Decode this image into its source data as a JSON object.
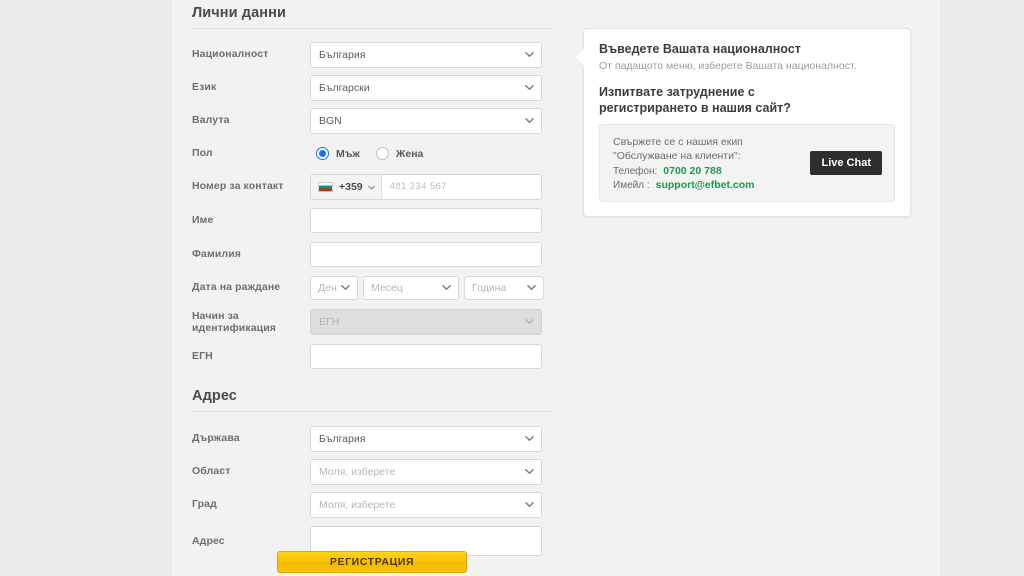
{
  "sections": {
    "personal": {
      "title": "Лични данни"
    },
    "address": {
      "title": "Адрес"
    }
  },
  "fields": {
    "nationality": {
      "label": "Националност",
      "value": "България"
    },
    "language": {
      "label": "Език",
      "value": "Български"
    },
    "currency": {
      "label": "Валута",
      "value": "BGN"
    },
    "gender": {
      "label": "Пол",
      "options": [
        {
          "label": "Мъж",
          "selected": true
        },
        {
          "label": "Жена",
          "selected": false
        }
      ]
    },
    "phone": {
      "label": "Номер за контакт",
      "dial_code": "+359",
      "placeholder": "481 234 567",
      "flag": "bulgaria-flag-icon"
    },
    "first_name": {
      "label": "Име",
      "value": ""
    },
    "last_name": {
      "label": "Фамилия",
      "value": ""
    },
    "dob": {
      "label": "Дата на раждане",
      "day": "Ден",
      "month": "Месец",
      "year": "Година"
    },
    "id_method": {
      "label": "Начин за идентификация",
      "value": "ЕГН",
      "disabled": true
    },
    "egn": {
      "label": "ЕГН",
      "value": ""
    },
    "country": {
      "label": "Държава",
      "value": "България"
    },
    "region": {
      "label": "Област",
      "value": "Моля, изберете"
    },
    "city": {
      "label": "Град",
      "value": "Моля, изберете"
    },
    "address": {
      "label": "Адрес",
      "value": ""
    }
  },
  "tooltip": {
    "title": "Въведете Вашата националност",
    "subtitle": "От падащото меню, изберете Вашата националност.",
    "question_line1": "Изпитвате затруднение с",
    "question_line2": "регистрирането в нашия сайт?",
    "contact": {
      "line1": "Свържете се с нашия екип",
      "line2": "\"Обслужване на клиенти\":",
      "phone_label": "Телефон:",
      "phone_value": "0700 20 788",
      "email_label": "Имейл :",
      "email_value": "support@efbet.com"
    },
    "live_chat_label": "Live Chat"
  },
  "submit": {
    "label": "РЕГИСТРАЦИЯ"
  },
  "status": {
    "nationality_valid_icon": "check-circle-icon"
  },
  "colors": {
    "accent_green": "#1a9a4b",
    "badge_green": "#20a050",
    "radio_blue": "#1a73e8",
    "submit_yellow": "#fbc500",
    "live_chat_dark": "#2e2e2e"
  }
}
